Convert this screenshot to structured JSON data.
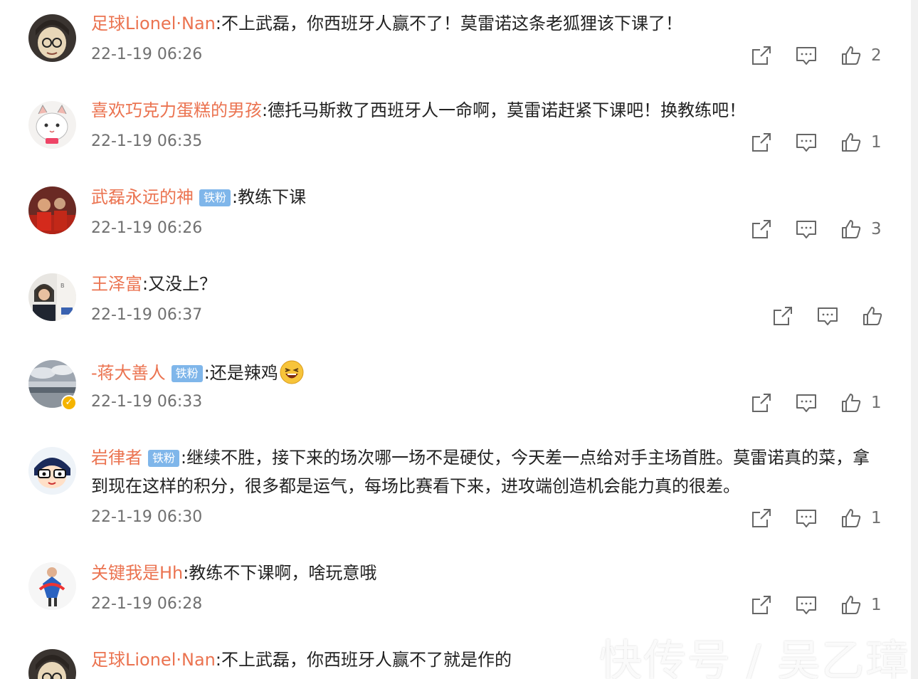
{
  "comments": [
    {
      "username": "足球Lionel·Nan",
      "badge": "",
      "text": ":不上武磊，你西班牙人赢不了！莫雷诺这条老狐狸该下课了！",
      "text2": "",
      "time": "22-1-19 06:26",
      "likes": "2",
      "avatar_icon": "detective-avatar",
      "verified": false
    },
    {
      "username": "喜欢巧克力蛋糕的男孩",
      "badge": "",
      "text": ":德托马斯救了西班牙人一命啊，莫雷诺赶紧下课吧！换教练吧！",
      "text2": "",
      "time": "22-1-19 06:35",
      "likes": "1",
      "avatar_icon": "cat-avatar",
      "verified": false
    },
    {
      "username": "武磊永远的神",
      "badge": "铁粉",
      "text": ":教练下课",
      "text2": "",
      "time": "22-1-19 06:26",
      "likes": "3",
      "avatar_icon": "player-avatar",
      "verified": false
    },
    {
      "username": "王泽富",
      "badge": "",
      "text": ":又没上？",
      "text2": "",
      "time": "22-1-19 06:37",
      "likes": "",
      "avatar_icon": "photo-avatar",
      "verified": false
    },
    {
      "username": "-蒋大善人",
      "badge": "铁粉",
      "text": ":还是辣鸡",
      "text2": "",
      "time": "22-1-19 06:33",
      "likes": "1",
      "avatar_icon": "landscape-avatar",
      "verified": true
    },
    {
      "username": "岩律者",
      "badge": "铁粉",
      "text": ":继续不胜，接下来的场次哪一场不是硬仗，今天差一点给对手主场首胜。莫雷诺真的菜，拿",
      "text2": "到现在这样的积分，很多都是运气，每场比赛看下来，进攻端创造机会能力真的很差。",
      "time": "22-1-19 06:30",
      "likes": "1",
      "avatar_icon": "cartoon-avatar",
      "verified": false
    },
    {
      "username": "关键我是Hh",
      "badge": "",
      "text": ":教练不下课啊，啥玩意哦",
      "text2": "",
      "time": "22-1-19 06:28",
      "likes": "1",
      "avatar_icon": "illustration-avatar",
      "verified": false
    },
    {
      "username": "足球Lionel·Nan",
      "badge": "",
      "text": ":不上武磊，你西班牙人赢不了就是作的",
      "text2": "",
      "time": "",
      "likes": "",
      "avatar_icon": "detective-avatar",
      "verified": false
    }
  ],
  "icons": {
    "share": "share-icon",
    "comment": "comment-icon",
    "like": "thumbs-up-icon",
    "emoji": "laughing-emoji-icon"
  },
  "colors": {
    "username": "#eb7350",
    "badge": "#7fb6ea",
    "text": "#222222",
    "meta": "#707070"
  },
  "watermark": "快传号 / 吴乙璋"
}
